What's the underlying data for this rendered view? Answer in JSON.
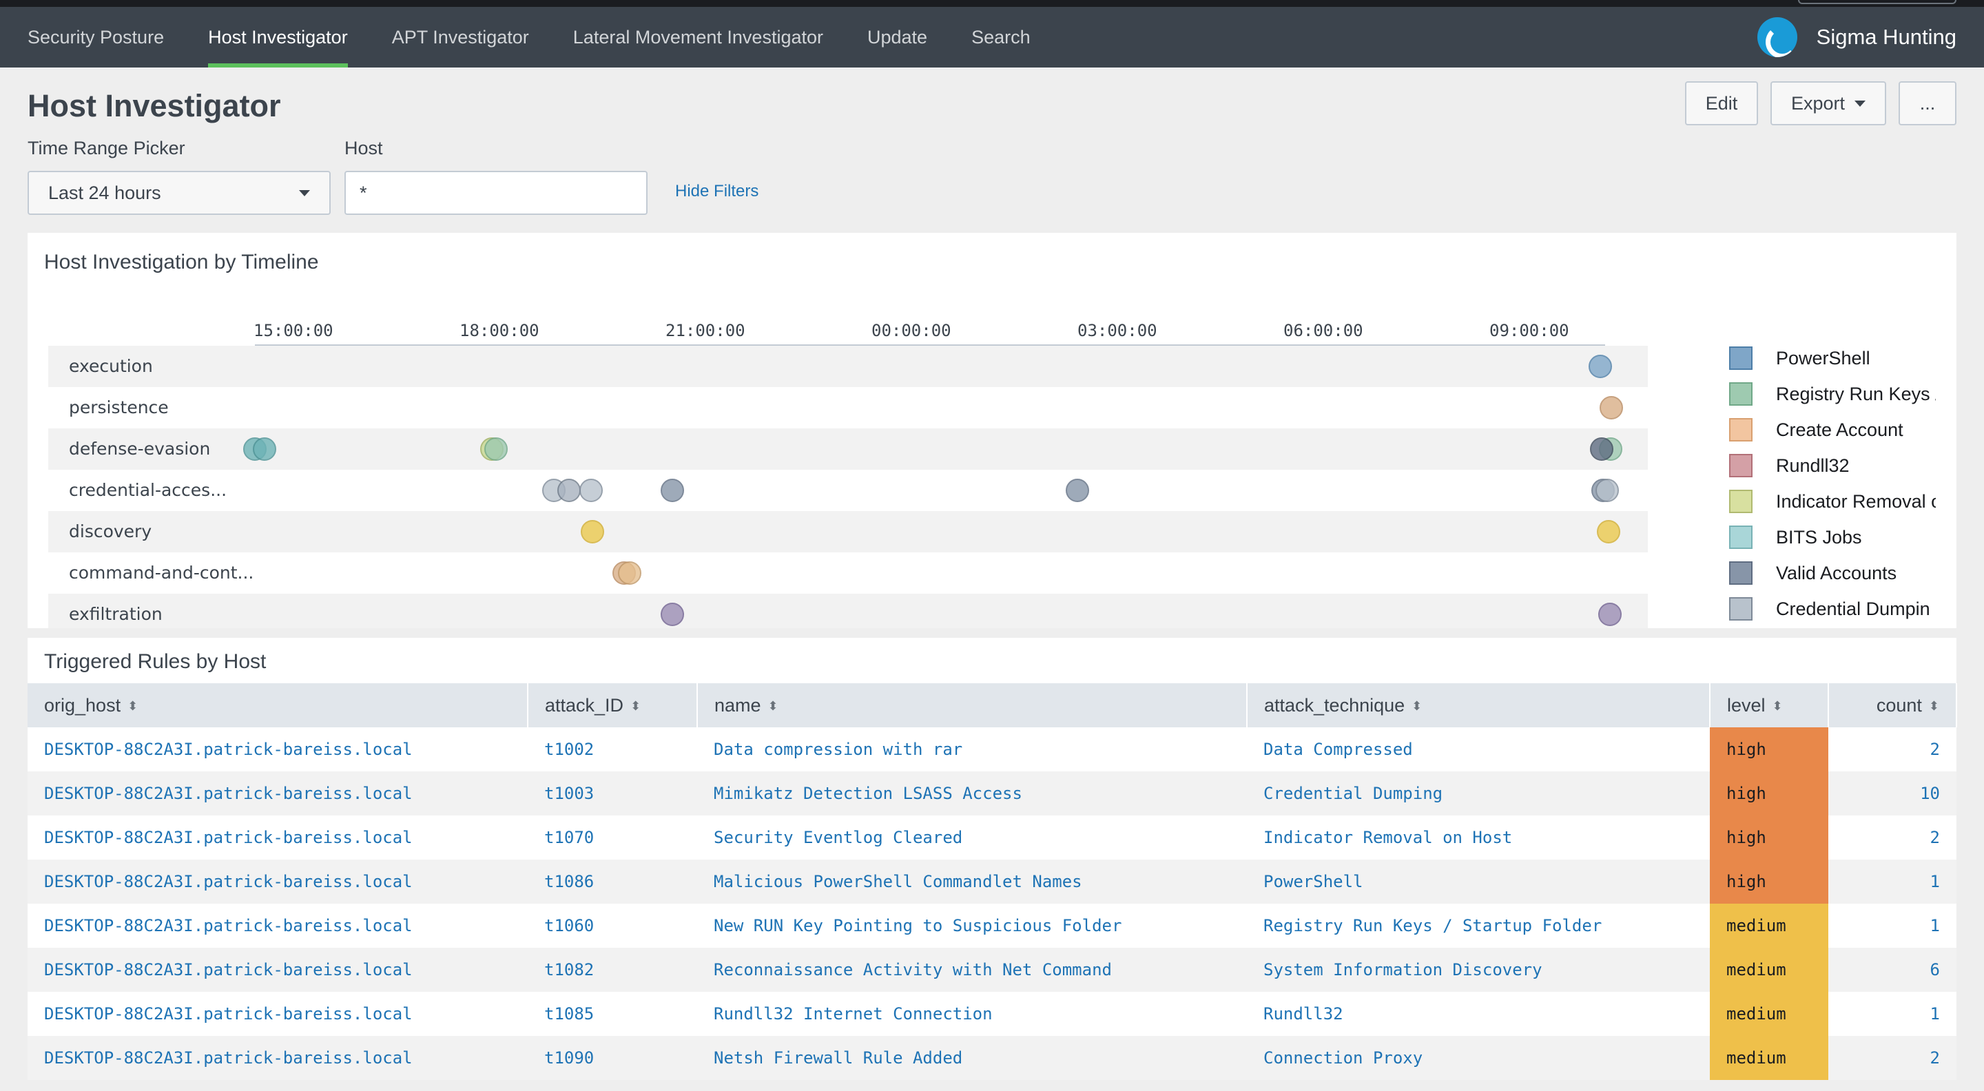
{
  "nav": {
    "items": [
      "Security Posture",
      "Host Investigator",
      "APT Investigator",
      "Lateral Movement Investigator",
      "Update",
      "Search"
    ],
    "active": "Host Investigator",
    "brand": "Sigma Hunting"
  },
  "page": {
    "title": "Host Investigator",
    "edit_label": "Edit",
    "export_label": "Export",
    "more_label": "..."
  },
  "filters": {
    "time_label": "Time Range Picker",
    "time_value": "Last 24 hours",
    "host_label": "Host",
    "host_value": "*",
    "hide_label": "Hide Filters"
  },
  "timeline": {
    "title": "Host Investigation by Timeline",
    "ticks": [
      "15:00:00",
      "18:00:00",
      "21:00:00",
      "00:00:00",
      "03:00:00",
      "06:00:00",
      "09:00:00"
    ],
    "rows": [
      "execution",
      "persistence",
      "defense-evasion",
      "credential-acces...",
      "discovery",
      "command-and-cont...",
      "exfiltration"
    ],
    "legend": [
      "PowerShell",
      "Registry Run Keys /",
      "Create Account",
      "Rundll32",
      "Indicator Removal o",
      "BITS Jobs",
      "Valid Accounts",
      "Credential Dumpin"
    ]
  },
  "colors": {
    "PowerShell": "#7fa6c8",
    "Registry Run Keys": "#9ecab0",
    "Create Account": "#f2c5a0",
    "Rundll32": "#d4a0a6",
    "Indicator Removal": "#d8e0a0",
    "BITS Jobs": "#a9d6d8",
    "Valid Accounts": "#8795a8",
    "Credential Dumping": "#b8c2cc",
    "yellow": "#ebc94e",
    "tan": "#d9ae86",
    "teal": "#6db3b6",
    "purple": "#9b8eb4",
    "level_high": "#e8884a",
    "level_medium": "#efc04a"
  },
  "table": {
    "title": "Triggered Rules by Host",
    "columns": [
      "orig_host",
      "attack_ID",
      "name",
      "attack_technique",
      "level",
      "count"
    ],
    "rows": [
      {
        "orig_host": "DESKTOP-88C2A3I.patrick-bareiss.local",
        "attack_ID": "t1002",
        "name": "Data compression with rar",
        "attack_technique": "Data Compressed",
        "level": "high",
        "count": "2"
      },
      {
        "orig_host": "DESKTOP-88C2A3I.patrick-bareiss.local",
        "attack_ID": "t1003",
        "name": "Mimikatz Detection LSASS Access",
        "attack_technique": "Credential Dumping",
        "level": "high",
        "count": "10"
      },
      {
        "orig_host": "DESKTOP-88C2A3I.patrick-bareiss.local",
        "attack_ID": "t1070",
        "name": "Security Eventlog Cleared",
        "attack_technique": "Indicator Removal on Host",
        "level": "high",
        "count": "2"
      },
      {
        "orig_host": "DESKTOP-88C2A3I.patrick-bareiss.local",
        "attack_ID": "t1086",
        "name": "Malicious PowerShell Commandlet Names",
        "attack_technique": "PowerShell",
        "level": "high",
        "count": "1"
      },
      {
        "orig_host": "DESKTOP-88C2A3I.patrick-bareiss.local",
        "attack_ID": "t1060",
        "name": "New RUN Key Pointing to Suspicious Folder",
        "attack_technique": "Registry Run Keys / Startup Folder",
        "level": "medium",
        "count": "1"
      },
      {
        "orig_host": "DESKTOP-88C2A3I.patrick-bareiss.local",
        "attack_ID": "t1082",
        "name": "Reconnaissance Activity with Net Command",
        "attack_technique": "System Information Discovery",
        "level": "medium",
        "count": "6"
      },
      {
        "orig_host": "DESKTOP-88C2A3I.patrick-bareiss.local",
        "attack_ID": "t1085",
        "name": "Rundll32 Internet Connection",
        "attack_technique": "Rundll32",
        "level": "medium",
        "count": "1"
      },
      {
        "orig_host": "DESKTOP-88C2A3I.patrick-bareiss.local",
        "attack_ID": "t1090",
        "name": "Netsh Firewall Rule Added",
        "attack_technique": "Connection Proxy",
        "level": "medium",
        "count": "2"
      }
    ]
  }
}
